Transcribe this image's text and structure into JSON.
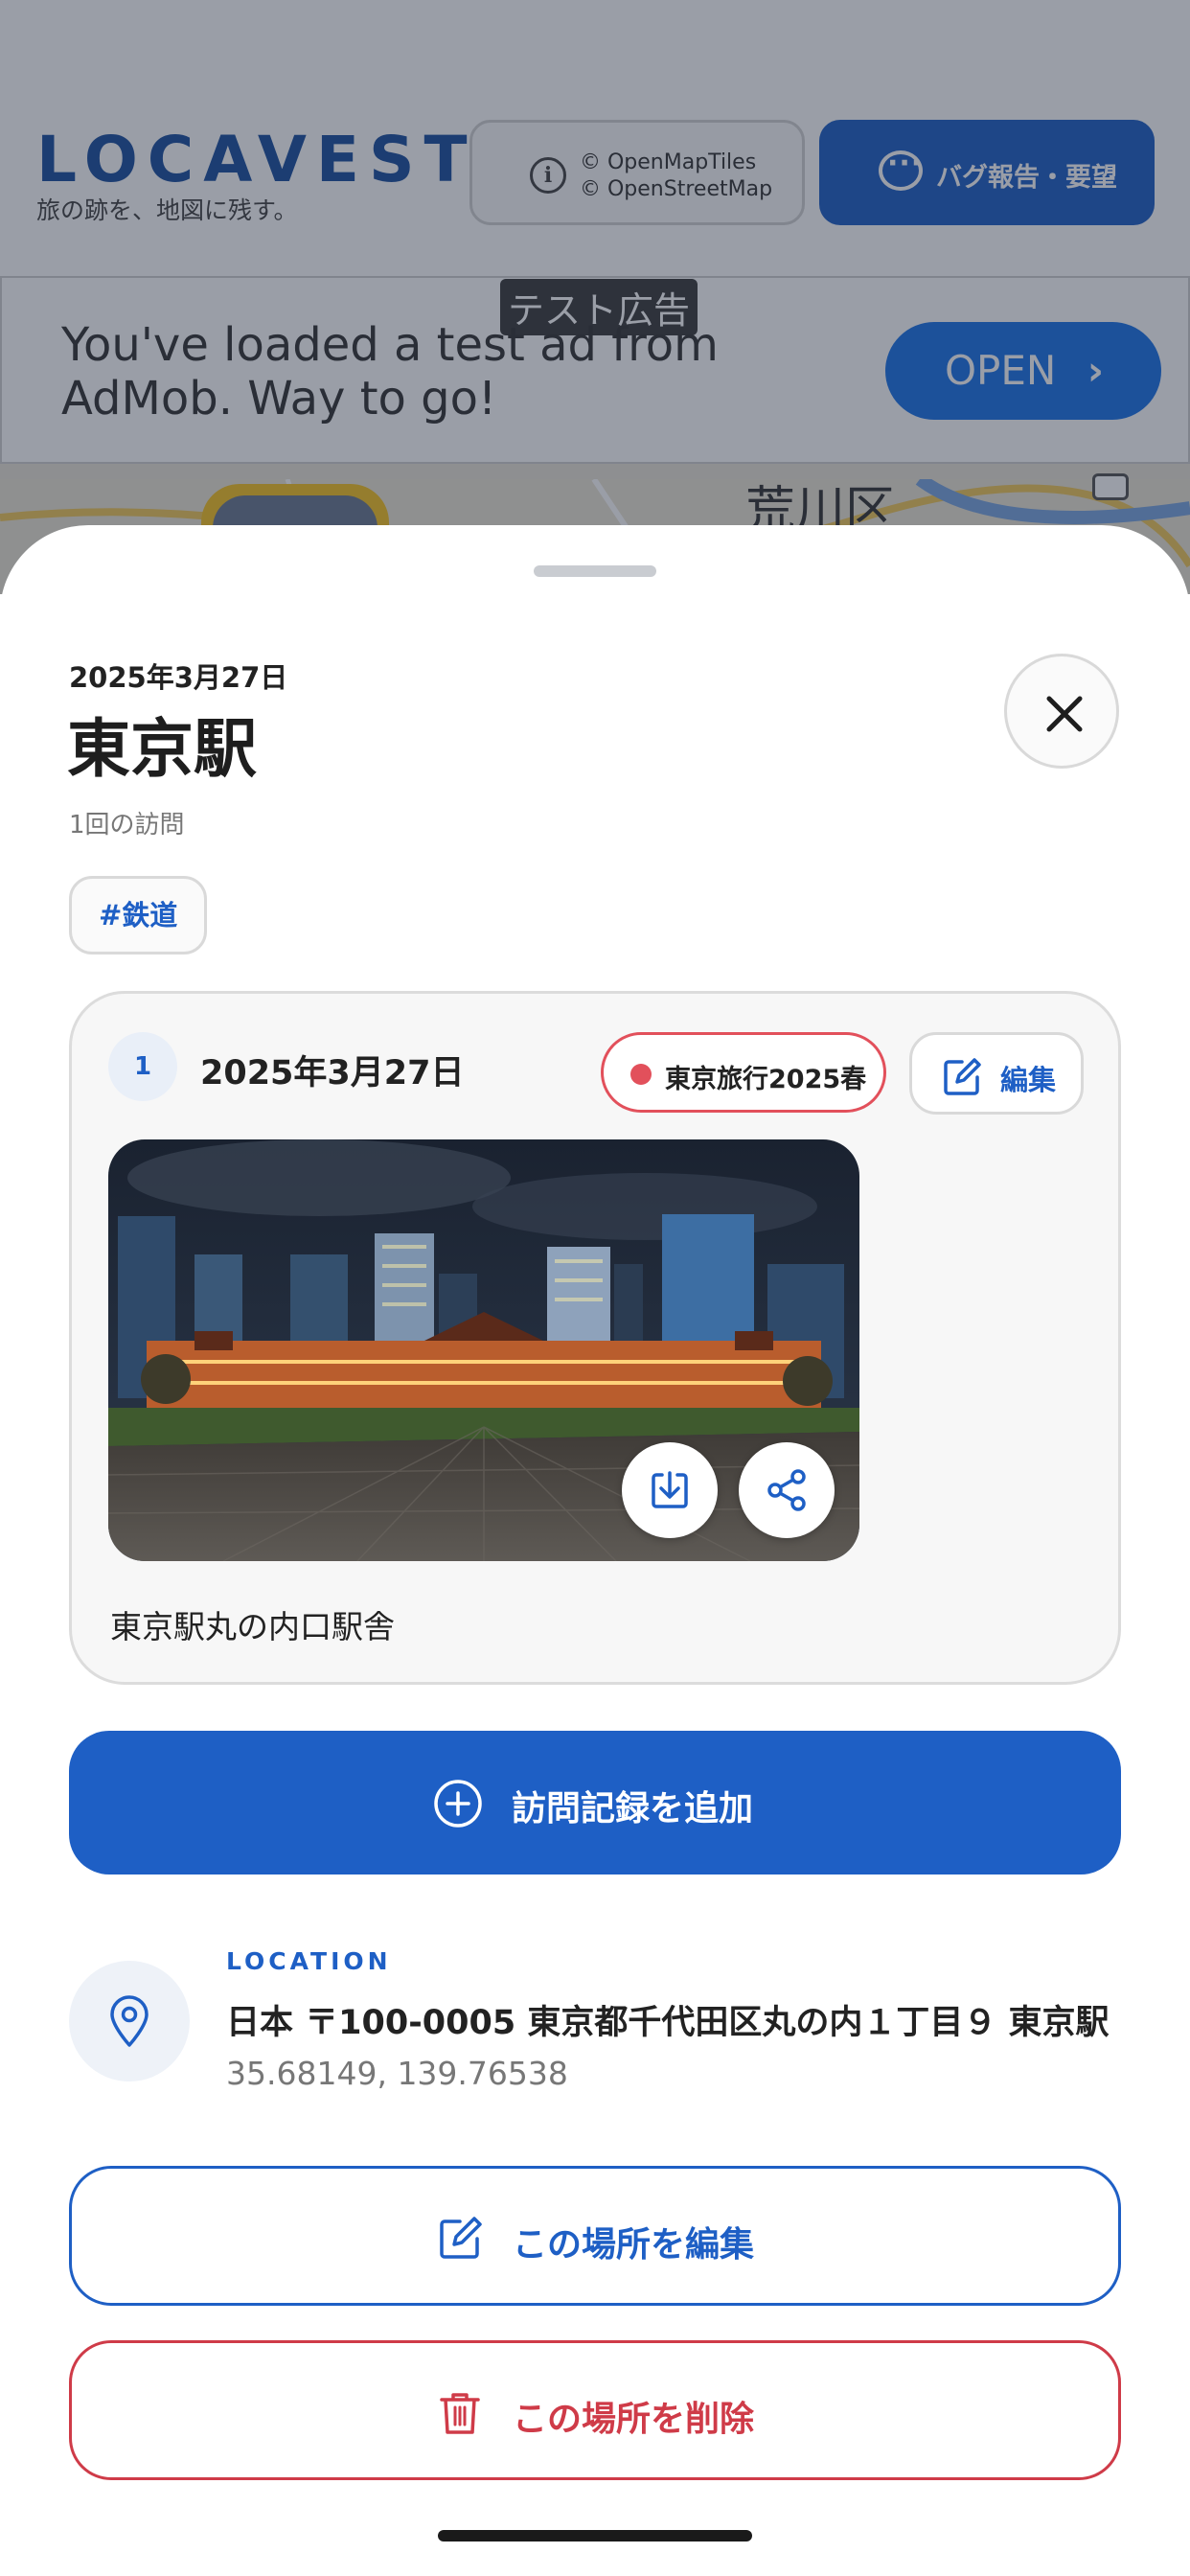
{
  "app": {
    "brand": "LOCAVESTA",
    "tagline": "旅の跡を、地図に残す。",
    "attribution": [
      "© OpenMapTiles",
      "© OpenStreetMap"
    ],
    "bug_report_label": "バグ報告・要望"
  },
  "ad": {
    "badge": "テスト広告",
    "text": "You've loaded a test ad from AdMob. Way to go!",
    "cta": "OPEN"
  },
  "map": {
    "visible_label": "荒川区"
  },
  "place": {
    "date": "2025年3月27日",
    "name": "東京駅",
    "visit_count": "1回の訪問",
    "tags": [
      "#鉄道"
    ]
  },
  "visits": [
    {
      "number": "1",
      "date": "2025年3月27日",
      "trip": "東京旅行2025春",
      "trip_color": "#e2505b",
      "edit_label": "編集",
      "caption": "東京駅丸の内口駅舎"
    }
  ],
  "actions": {
    "add_visit": "訪問記録を追加",
    "edit_place": "この場所を編集",
    "delete_place": "この場所を削除"
  },
  "location": {
    "label": "LOCATION",
    "address": "日本 〒100-0005 東京都千代田区丸の内１丁目９ 東京駅",
    "coords": "35.68149, 139.76538"
  },
  "colors": {
    "primary": "#1e5fc5",
    "danger": "#cf3b48",
    "ad_button": "#1a73e8"
  },
  "icons": {
    "close": "close-icon",
    "edit": "edit-icon",
    "download": "download-icon",
    "share": "share-icon",
    "add": "plus-circle-icon",
    "location": "map-pin-icon",
    "delete": "trash-icon",
    "info": "info-icon",
    "chat": "chat-bubble-icon"
  }
}
